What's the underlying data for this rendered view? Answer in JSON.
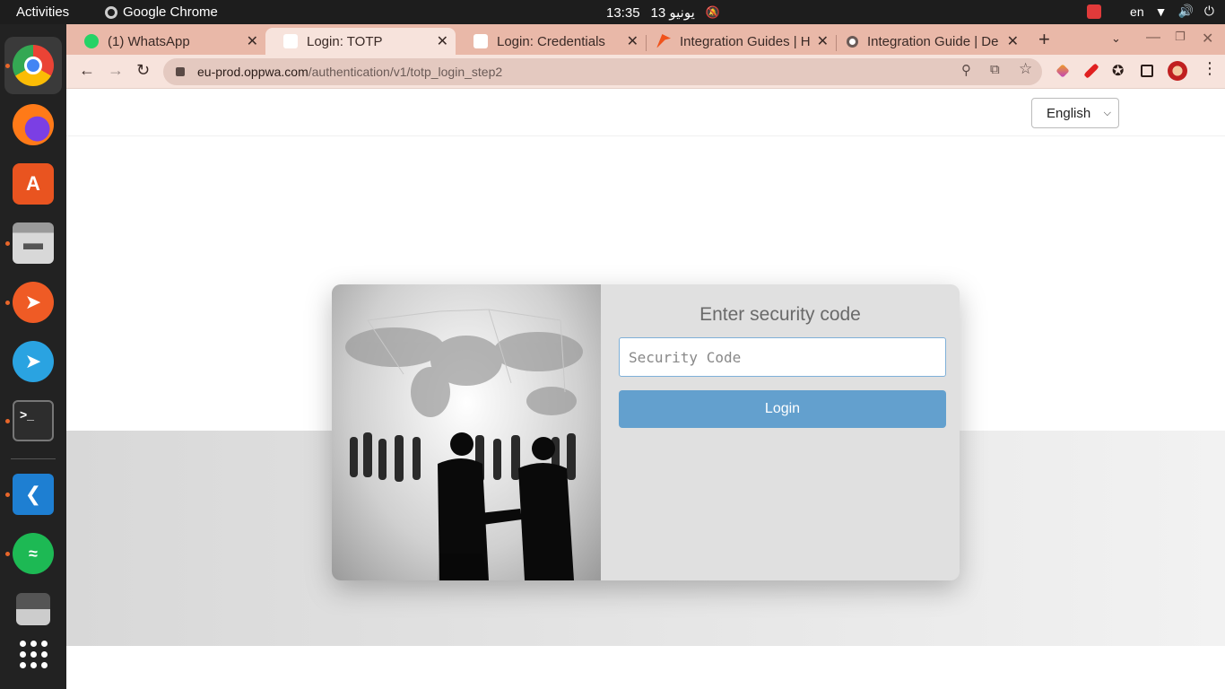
{
  "system_bar": {
    "activities": "Activities",
    "app_name": "Google Chrome",
    "time": "13:35",
    "date": "13 يونيو",
    "lang": "en"
  },
  "tabs": [
    {
      "title": "(1) WhatsApp",
      "favicon_color": "#25d366"
    },
    {
      "title": "Login: TOTP",
      "favicon_color": "#ffffff"
    },
    {
      "title": "Login: Credentials",
      "favicon_color": "#ffffff"
    },
    {
      "title": "Integration Guides | H",
      "favicon_color": "#f0531c"
    },
    {
      "title": "Integration Guide | De",
      "favicon_color": "#6a5a56"
    }
  ],
  "address_bar": {
    "host": "eu-prod.oppwa.com",
    "path": "/authentication/v1/totp_login_step2"
  },
  "page": {
    "language_select": "English",
    "heading": "Enter security code",
    "code_placeholder": "Security Code",
    "login_label": "Login"
  },
  "colors": {
    "accent_button": "#63a0ce",
    "tab_strip": "#e9b8a8"
  }
}
